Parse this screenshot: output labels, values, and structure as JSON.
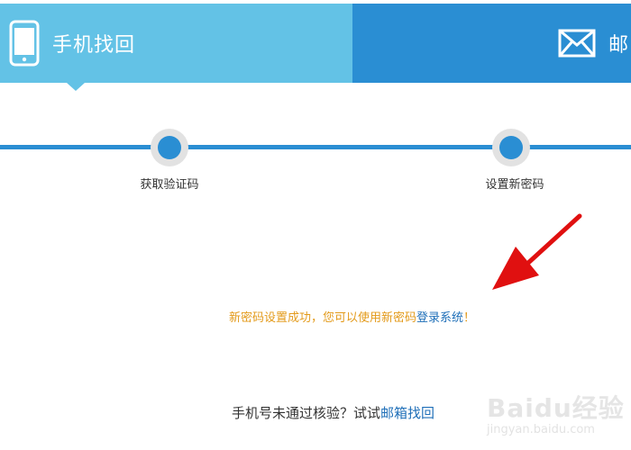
{
  "tabs": {
    "phone": {
      "label": "手机找回",
      "icon": "phone-icon",
      "color": "#63c2e6"
    },
    "email": {
      "label": "邮",
      "icon": "mail-icon",
      "color": "#2a8ed3"
    }
  },
  "steps": [
    {
      "label": "获取验证码"
    },
    {
      "label": "设置新密码"
    }
  ],
  "success": {
    "text": "新密码设置成功，您可以使用新密码",
    "link": "登录系统",
    "suffix": "！",
    "color": "#e39a1a"
  },
  "footer": {
    "text": "手机号未通过核验？试试",
    "link": "邮箱找回"
  },
  "watermark": {
    "brand": "Baidu经验",
    "url": "jingyan.baidu.com"
  },
  "colors": {
    "accent": "#2a8ed3",
    "link": "#1f6fb8",
    "annotation": "#e01010"
  }
}
